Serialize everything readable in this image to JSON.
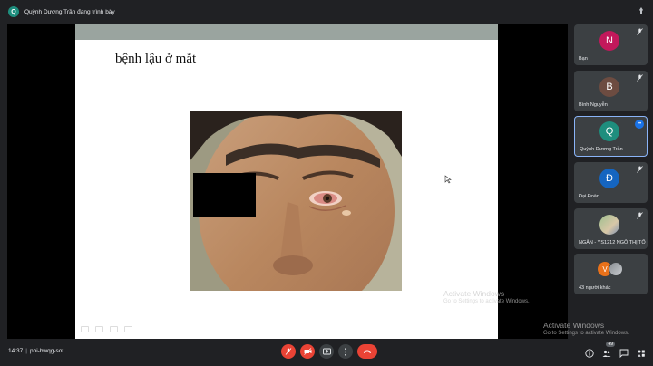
{
  "topbar": {
    "presenter_initial": "Q",
    "presenter_text": "Quỳnh Dương Trần đang trình bày"
  },
  "slide": {
    "title": "bệnh lậu ở mắt"
  },
  "watermarks": [
    {
      "title": "Activate Windows",
      "subtitle": "Go to Settings to activate Windows."
    },
    {
      "title": "Activate Windows",
      "subtitle": "Go to Settings to activate Windows."
    }
  ],
  "participants": [
    {
      "initial": "N",
      "name": "Bạn",
      "color": "#c2185b"
    },
    {
      "initial": "B",
      "name": "Bình Nguyễn",
      "color": "#6d4c41"
    },
    {
      "initial": "Q",
      "name": "Quỳnh Dương Trần",
      "color": "#1e8e7e"
    },
    {
      "initial": "Đ",
      "name": "Đại Đoàn",
      "color": "#1565c0"
    },
    {
      "initial": "",
      "name": "NGÂN - YS1212 NGÔ THỊ TỐ",
      "color": "#9fbf8f"
    },
    {
      "initial": "V",
      "name": "43 người khác",
      "color": "#e8711a"
    }
  ],
  "bottom": {
    "time": "14:37",
    "separator": "|",
    "meeting_code": "phi-bwqg-sot"
  },
  "icons": {
    "mic_off": "mic-off-icon",
    "cam_off": "camera-off-icon",
    "present": "present-icon",
    "more": "more-icon",
    "end_call": "end-call-icon",
    "info": "info-icon",
    "people": "people-icon",
    "chat": "chat-icon",
    "activities": "activities-icon"
  },
  "people_count": "49"
}
